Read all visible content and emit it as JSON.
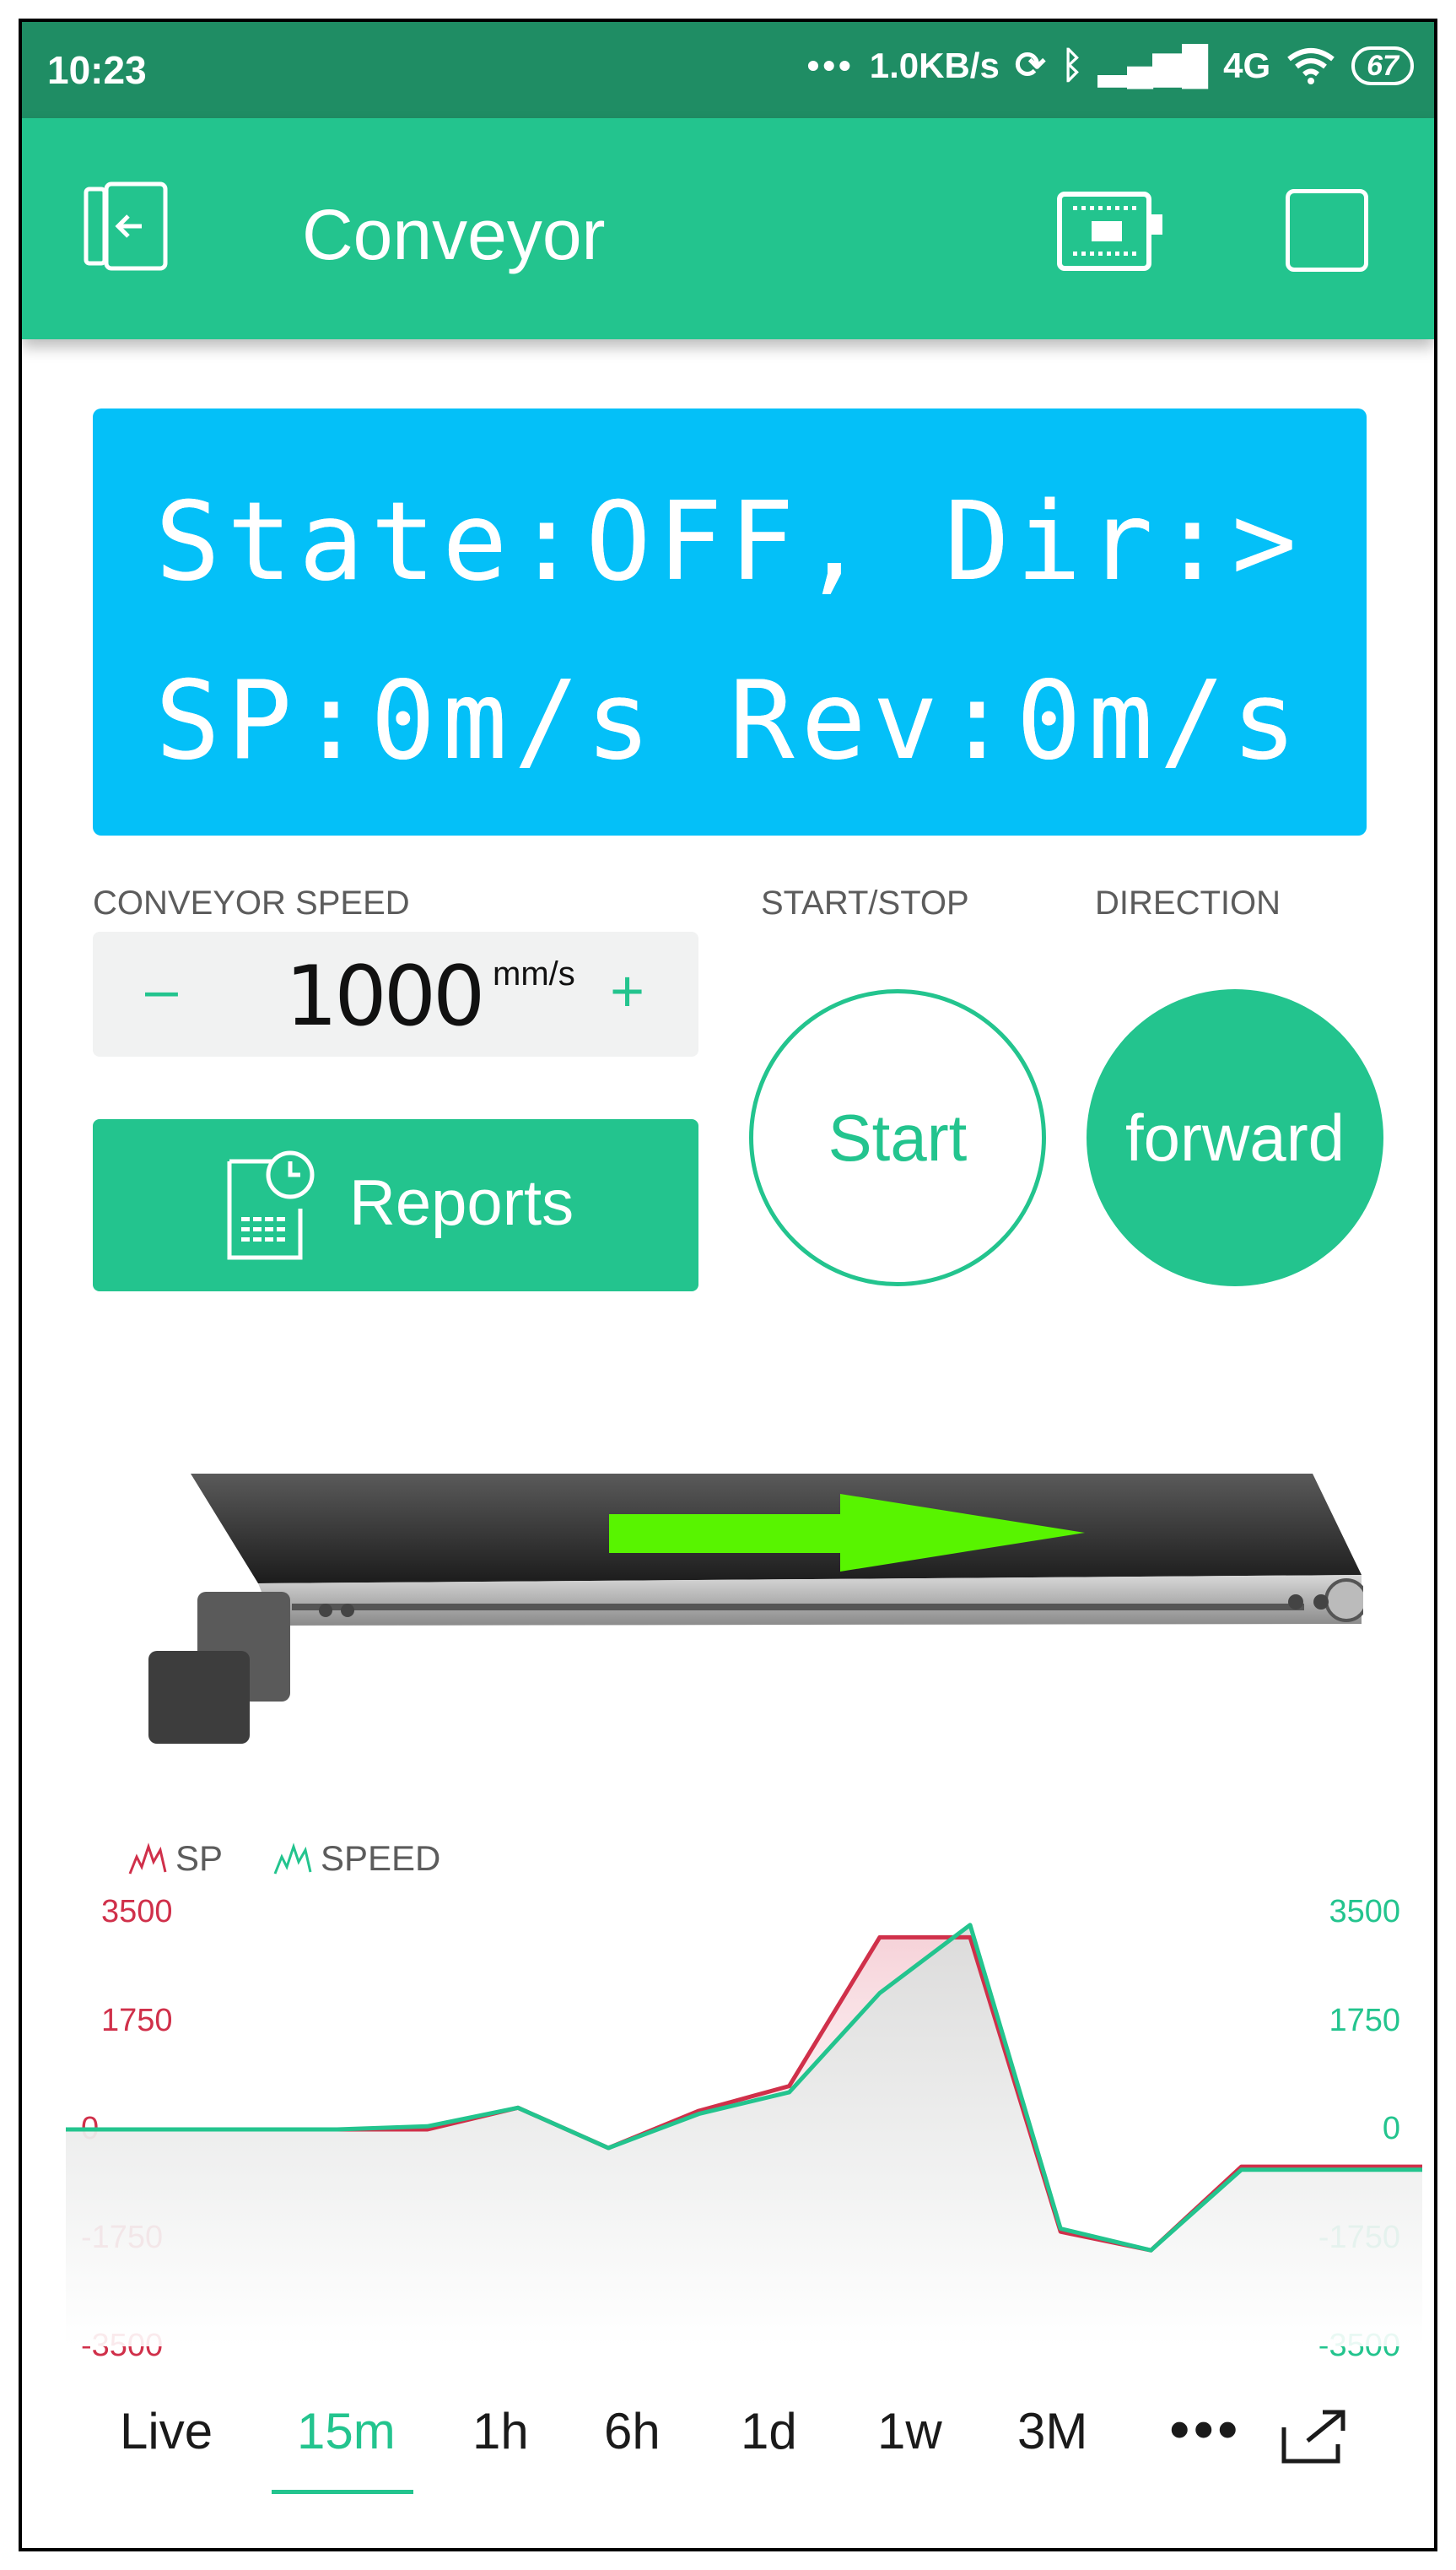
{
  "status_bar": {
    "time": "10:23",
    "net_speed": "1.0KB/s",
    "network": "4G",
    "battery": "67"
  },
  "toolbar": {
    "title": "Conveyor",
    "back_icon": "exit-icon",
    "device_icon": "device-board-icon",
    "square_icon": "stop-square-icon"
  },
  "lcd": {
    "line1": "State:OFF, Dir:>",
    "line2": "SP:0m/s Rev:0m/s",
    "color": "#04c0f8"
  },
  "controls": {
    "speed_label": "CONVEYOR SPEED",
    "speed_value": "1000",
    "speed_unit": "mm/s",
    "minus": "–",
    "plus": "+",
    "start_stop_label": "START/STOP",
    "start_button": "Start",
    "direction_label": "DIRECTION",
    "direction_button": "forward",
    "reports_button": "Reports"
  },
  "colors": {
    "brand": "#23c48e",
    "status_bar": "#1f8d64",
    "sp_series": "#d0304a",
    "speed_series": "#23c48e"
  },
  "chart_data": {
    "type": "line",
    "legend": [
      "SP",
      "SPEED"
    ],
    "ylim": [
      -3500,
      3500
    ],
    "y_ticks_left": [
      "3500",
      "1750",
      "0",
      "-1750",
      "-3500"
    ],
    "y_ticks_right": [
      "3500",
      "1750",
      "0",
      "-1750",
      "-3500"
    ],
    "series": [
      {
        "name": "SP",
        "values": [
          0,
          0,
          0,
          0,
          0,
          350,
          -300,
          300,
          700,
          3100,
          3100,
          -1650,
          -1950,
          -600,
          -600,
          -600
        ]
      },
      {
        "name": "SPEED",
        "values": [
          0,
          0,
          0,
          0,
          50,
          350,
          -300,
          250,
          600,
          2200,
          3300,
          -1600,
          -1950,
          -650,
          -650,
          -650
        ]
      }
    ]
  },
  "time_tabs": {
    "items": [
      "Live",
      "15m",
      "1h",
      "6h",
      "1d",
      "1w",
      "3M"
    ],
    "active": "15m",
    "more": "•••"
  }
}
